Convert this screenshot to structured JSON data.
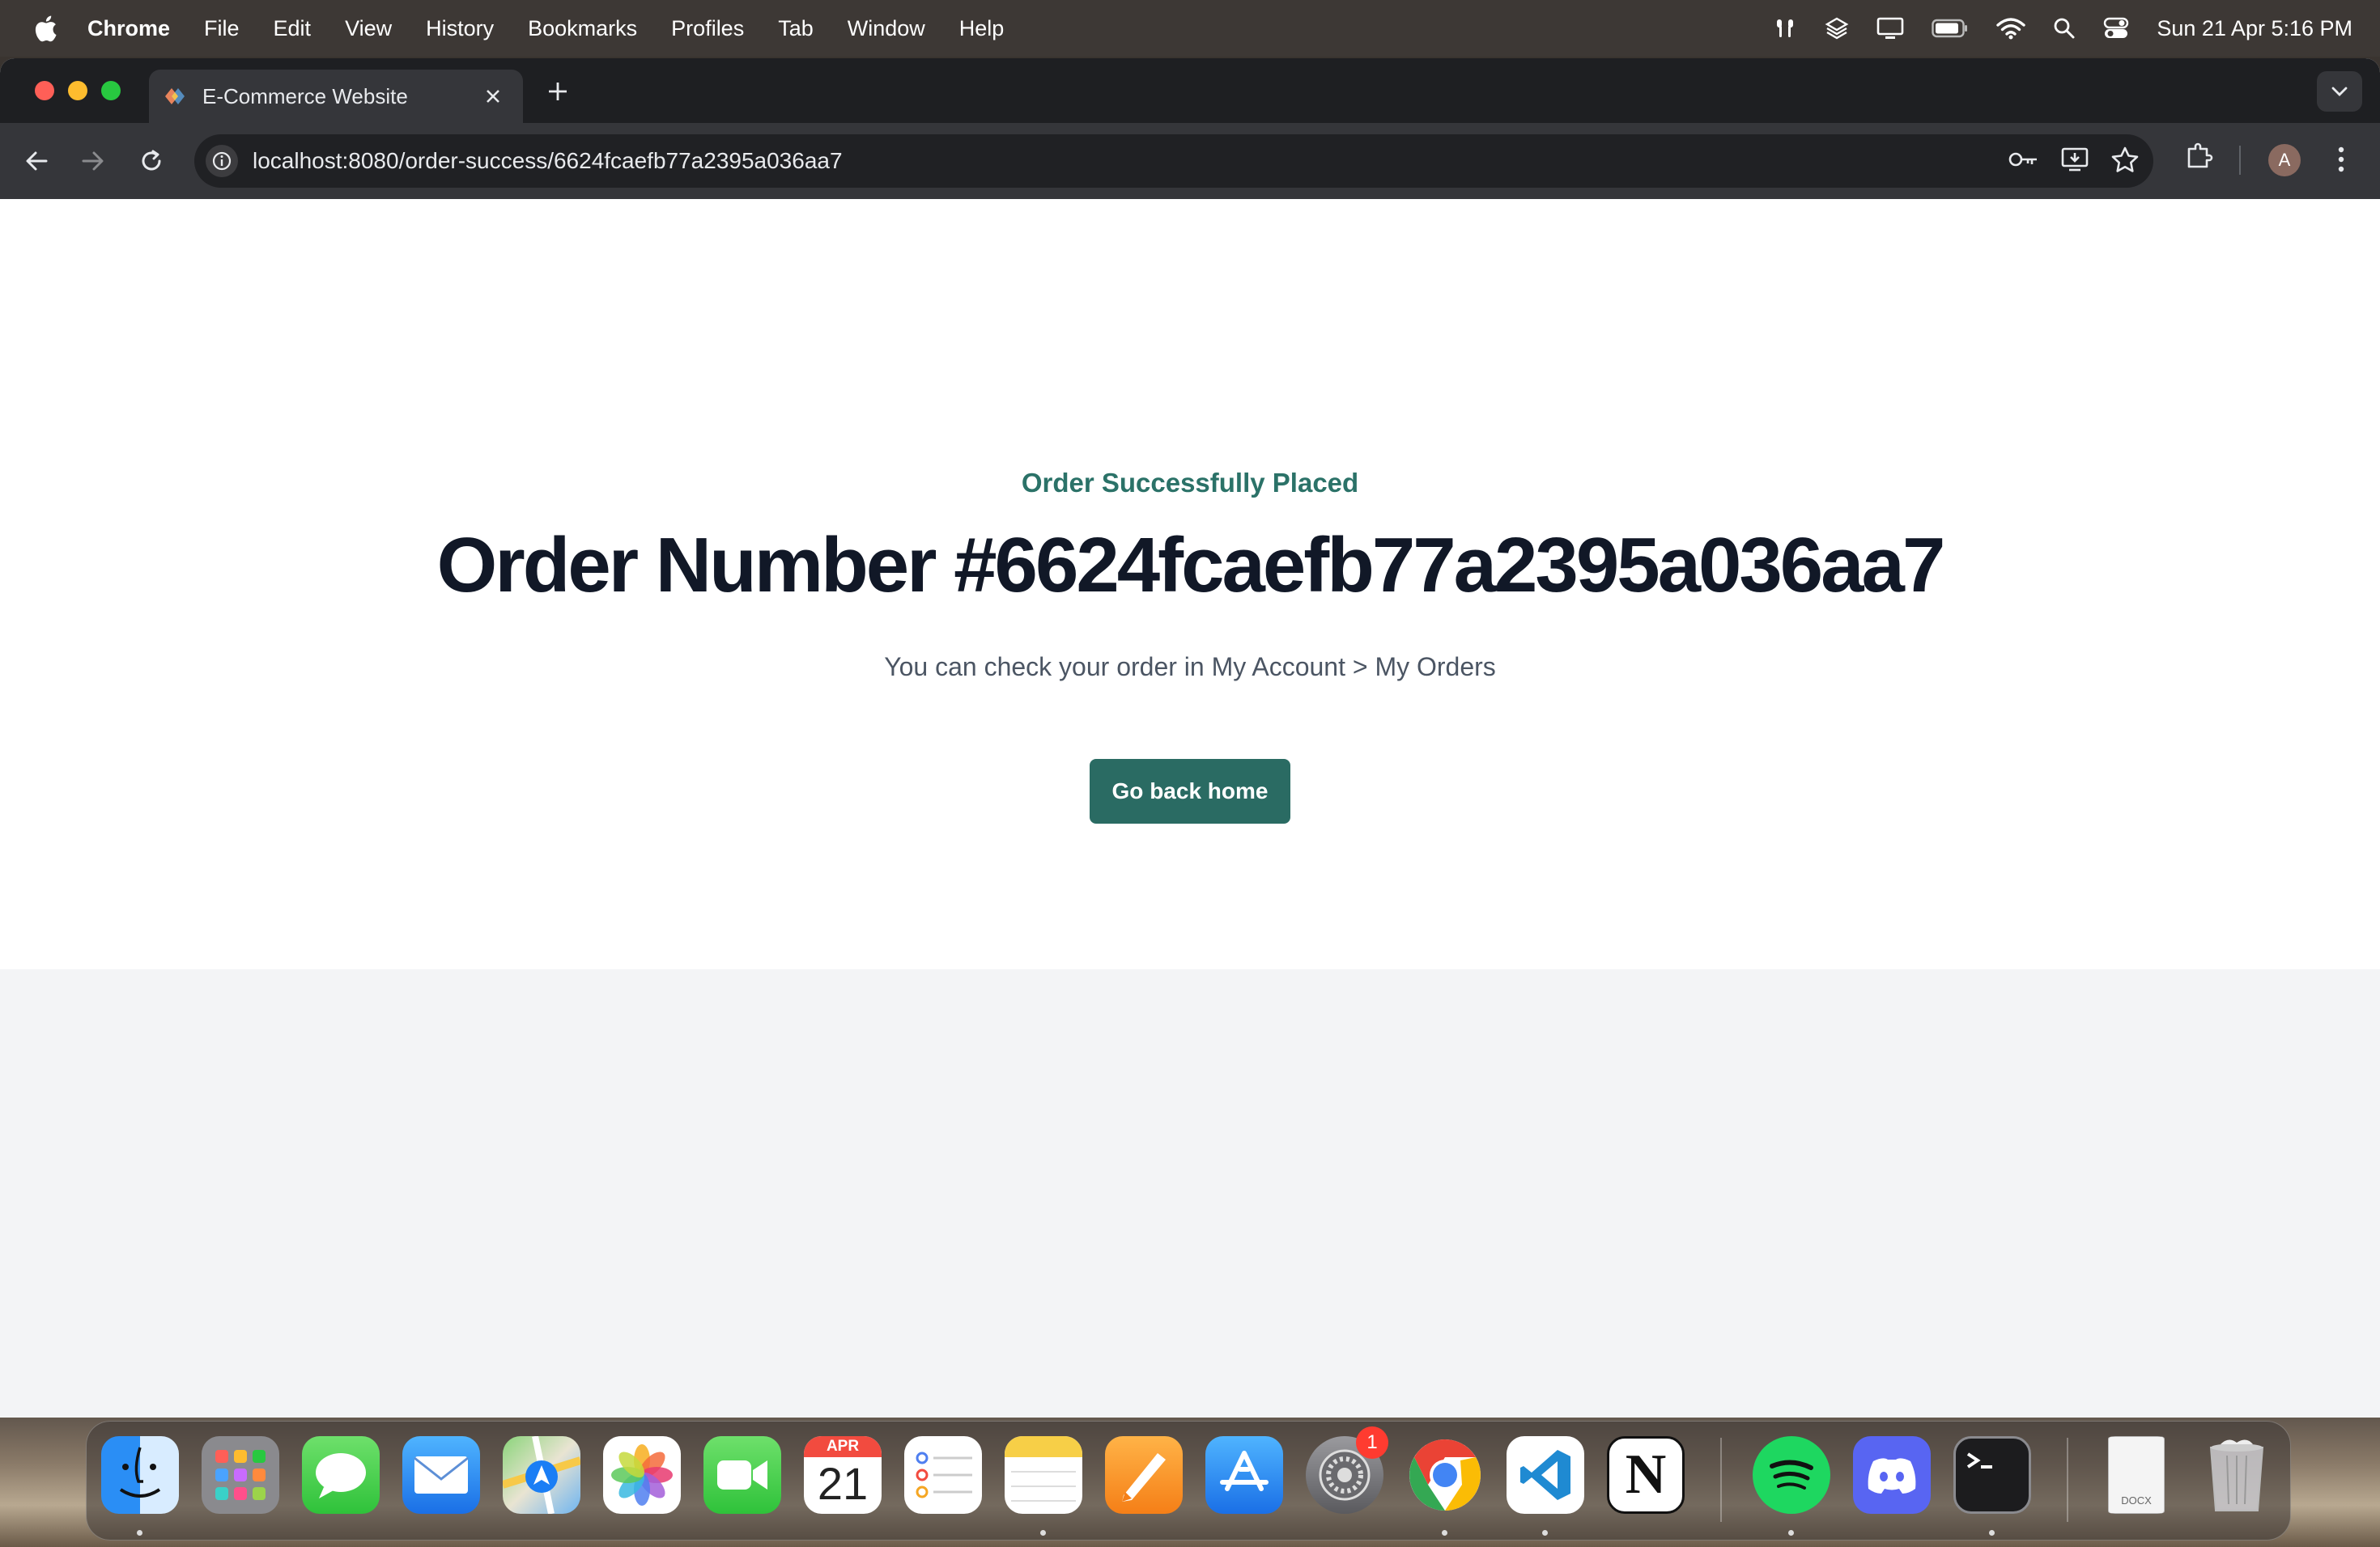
{
  "menubar": {
    "app_name": "Chrome",
    "items": [
      "File",
      "Edit",
      "View",
      "History",
      "Bookmarks",
      "Profiles",
      "Tab",
      "Window",
      "Help"
    ],
    "clock": "Sun 21 Apr  5:16 PM"
  },
  "browser": {
    "tab_title": "E-Commerce Website",
    "url": "localhost:8080/order-success/6624fcaefb77a2395a036aa7",
    "profile_initial": "A"
  },
  "page": {
    "eyebrow": "Order Successfully Placed",
    "order_title": "Order Number #6624fcaefb77a2395a036aa7",
    "subtitle": "You can check your order in My Account > My Orders",
    "home_button": "Go back home"
  },
  "dock": {
    "calendar_month": "APR",
    "calendar_day": "21",
    "settings_badge": "1",
    "docx_label": "DOCX"
  },
  "colors": {
    "accent": "#2a6b63",
    "eyebrow": "#2b7268",
    "title": "#111827"
  }
}
